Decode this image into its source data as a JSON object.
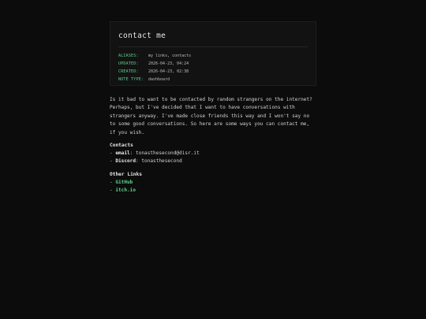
{
  "page": {
    "title": "contact me"
  },
  "meta": {
    "aliases_key": "ALIASES:",
    "aliases_val": "my links, contacts",
    "updated_key": "UPDATED:",
    "updated_val": "2026-04-23, 04:24",
    "created_key": "CREATED:",
    "created_val": "2026-04-23, 02:38",
    "notetype_key": "NOTE TYPE:",
    "notetype_val": "dashboard"
  },
  "content": {
    "intro": "Is it bad to want to be contacted by random strangers on the internet? Perhaps, but I've decided that I want to have conversations with strangers anyway. I've made close friends this way and I won't say no to some good conversations. So here are some ways you can contact me, if you wish.",
    "contacts_heading": "Contacts",
    "contacts": [
      {
        "label": "email",
        "value": "tonasthesecond@disr.it"
      },
      {
        "label": "Discord",
        "value": "tonasthesecond"
      }
    ],
    "other_heading": "Other Links",
    "links": [
      {
        "label": "GitHub"
      },
      {
        "label": "itch.io"
      }
    ],
    "dash": "- ",
    "colon": ": "
  },
  "colors": {
    "background": "#0c0c0c",
    "accent": "#5fd08a",
    "text": "#d2d2d2"
  }
}
